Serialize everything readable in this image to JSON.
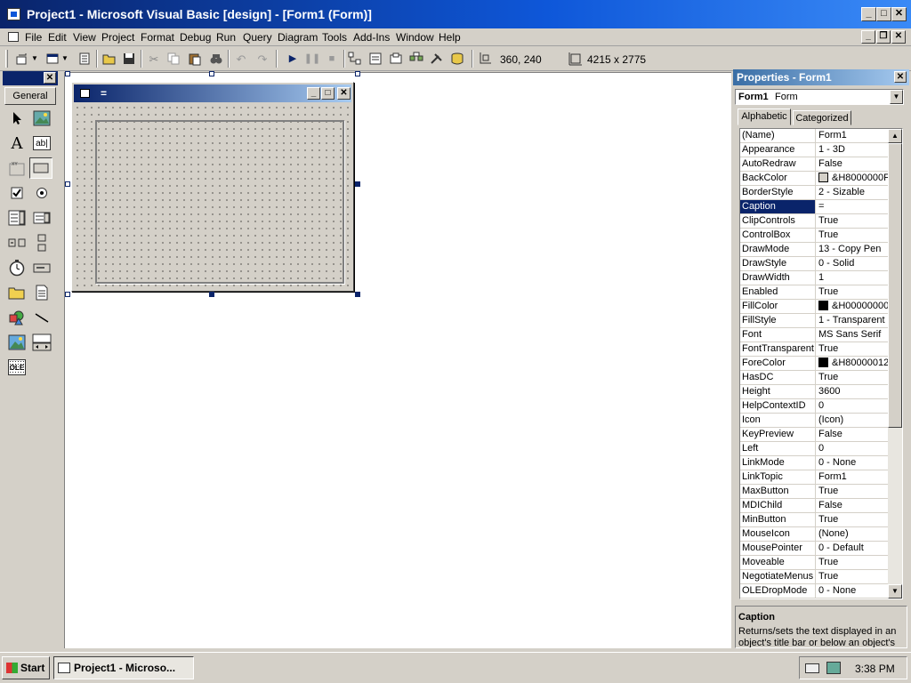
{
  "window": {
    "title": "Project1 - Microsoft Visual Basic [design] - [Form1 (Form)]",
    "controls": [
      "_",
      "□",
      "✕"
    ]
  },
  "menu": {
    "items": [
      "File",
      "Edit",
      "View",
      "Project",
      "Format",
      "Debug",
      "Run",
      "Query",
      "Diagram",
      "Tools",
      "Add-Ins",
      "Window",
      "Help"
    ],
    "mdi_controls": [
      "_",
      "❐",
      "✕"
    ]
  },
  "toolbar": {
    "position": "360, 240",
    "size": "4215 x 2775"
  },
  "toolbox": {
    "tab": "General",
    "close": "✕",
    "tools": [
      "pointer-icon",
      "picturebox-icon",
      "label-icon",
      "textbox-icon",
      "frame-icon",
      "commandbutton-icon",
      "checkbox-icon",
      "optionbutton-icon",
      "combobox-icon",
      "listbox-icon",
      "hscrollbar-icon",
      "vscrollbar-icon",
      "timer-icon",
      "drivelistbox-icon",
      "dirlistbox-icon",
      "filelistbox-icon",
      "shape-icon",
      "line-icon",
      "image-icon",
      "data-icon",
      "ole-icon"
    ],
    "labels": {
      "label": "A",
      "textbox": "ab|",
      "ole": "OLE"
    }
  },
  "form": {
    "caption": "=",
    "controls": [
      "_",
      "□",
      "✕"
    ]
  },
  "properties": {
    "title": "Properties - Form1",
    "object_name": "Form1",
    "object_type": "Form",
    "tabs": [
      "Alphabetic",
      "Categorized"
    ],
    "rows": [
      {
        "name": "(Name)",
        "value": "Form1"
      },
      {
        "name": "Appearance",
        "value": "1 - 3D"
      },
      {
        "name": "AutoRedraw",
        "value": "False"
      },
      {
        "name": "BackColor",
        "value": "&H8000000F",
        "swatch": "#d4d0c8"
      },
      {
        "name": "BorderStyle",
        "value": "2 - Sizable"
      },
      {
        "name": "Caption",
        "value": "=",
        "selected": true
      },
      {
        "name": "ClipControls",
        "value": "True"
      },
      {
        "name": "ControlBox",
        "value": "True"
      },
      {
        "name": "DrawMode",
        "value": "13 - Copy Pen"
      },
      {
        "name": "DrawStyle",
        "value": "0 - Solid"
      },
      {
        "name": "DrawWidth",
        "value": "1"
      },
      {
        "name": "Enabled",
        "value": "True"
      },
      {
        "name": "FillColor",
        "value": "&H00000000",
        "swatch": "#000000"
      },
      {
        "name": "FillStyle",
        "value": "1 - Transparent"
      },
      {
        "name": "Font",
        "value": "MS Sans Serif"
      },
      {
        "name": "FontTransparent",
        "value": "True"
      },
      {
        "name": "ForeColor",
        "value": "&H80000012",
        "swatch": "#000000"
      },
      {
        "name": "HasDC",
        "value": "True"
      },
      {
        "name": "Height",
        "value": "3600"
      },
      {
        "name": "HelpContextID",
        "value": "0"
      },
      {
        "name": "Icon",
        "value": "(Icon)"
      },
      {
        "name": "KeyPreview",
        "value": "False"
      },
      {
        "name": "Left",
        "value": "0"
      },
      {
        "name": "LinkMode",
        "value": "0 - None"
      },
      {
        "name": "LinkTopic",
        "value": "Form1"
      },
      {
        "name": "MaxButton",
        "value": "True"
      },
      {
        "name": "MDIChild",
        "value": "False"
      },
      {
        "name": "MinButton",
        "value": "True"
      },
      {
        "name": "MouseIcon",
        "value": "(None)"
      },
      {
        "name": "MousePointer",
        "value": "0 - Default"
      },
      {
        "name": "Moveable",
        "value": "True"
      },
      {
        "name": "NegotiateMenus",
        "value": "True"
      },
      {
        "name": "OLEDropMode",
        "value": "0 - None"
      }
    ],
    "description_title": "Caption",
    "description_text": "Returns/sets the text displayed in an object's title bar or below an object's"
  },
  "taskbar": {
    "start": "Start",
    "task": "Project1 - Microso...",
    "clock": "3:38 PM"
  },
  "colors": {
    "titlebar": "#0a246a",
    "face": "#d4d0c8",
    "selection": "#0a246a"
  }
}
